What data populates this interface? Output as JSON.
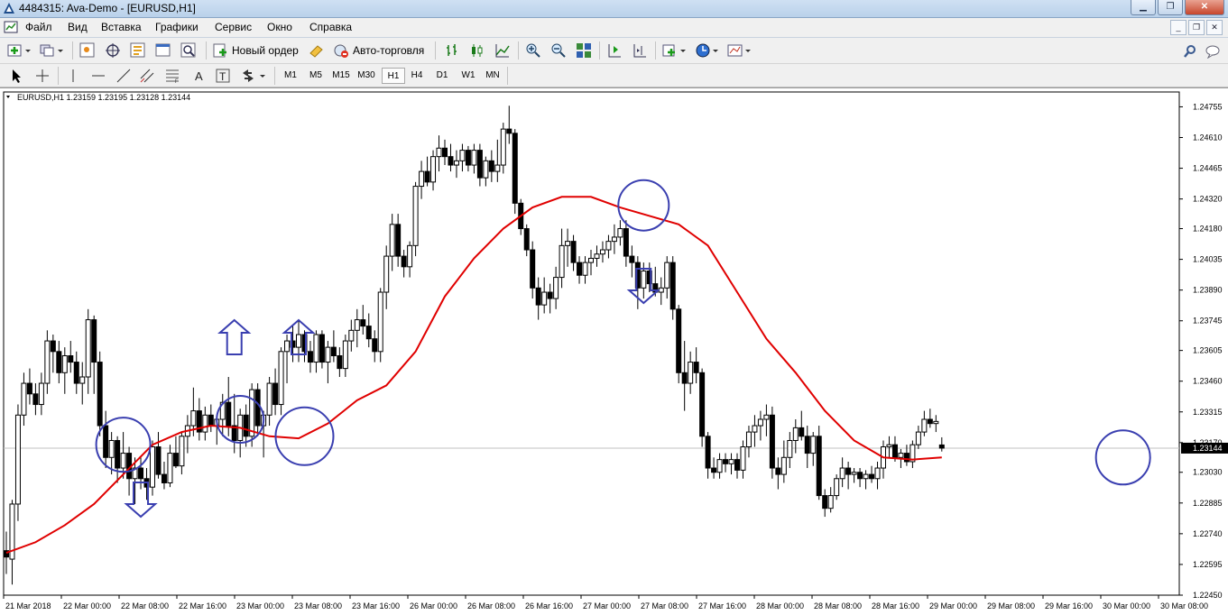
{
  "window": {
    "title": "4484315: Ava-Demo - [EURUSD,H1]"
  },
  "menu": [
    "Файл",
    "Вид",
    "Вставка",
    "Графики",
    "Сервис",
    "Окно",
    "Справка"
  ],
  "toolbar": {
    "new_order": "Новый ордер",
    "auto_trading": "Авто-торговля"
  },
  "timeframes": [
    "M1",
    "M5",
    "M15",
    "M30",
    "H1",
    "H4",
    "D1",
    "W1",
    "MN"
  ],
  "active_timeframe": "H1",
  "chart": {
    "symbol_label": "EURUSD,H1  1.23159 1.23195 1.23128 1.23144",
    "current_price": "1.23144",
    "price_ticks": [
      "1.24755",
      "1.24610",
      "1.24465",
      "1.24320",
      "1.24180",
      "1.24035",
      "1.23890",
      "1.23745",
      "1.23605",
      "1.23460",
      "1.23315",
      "1.23170",
      "1.23030",
      "1.22885",
      "1.22740",
      "1.22595",
      "1.22450"
    ],
    "time_ticks": [
      "21 Mar 2018",
      "22 Mar 00:00",
      "22 Mar 08:00",
      "22 Mar 16:00",
      "23 Mar 00:00",
      "23 Mar 08:00",
      "23 Mar 16:00",
      "26 Mar 00:00",
      "26 Mar 08:00",
      "26 Mar 16:00",
      "27 Mar 00:00",
      "27 Mar 08:00",
      "27 Mar 16:00",
      "28 Mar 00:00",
      "28 Mar 08:00",
      "28 Mar 16:00",
      "29 Mar 00:00",
      "29 Mar 08:00",
      "29 Mar 16:00",
      "30 Mar 00:00",
      "30 Mar 08:00"
    ],
    "colors": {
      "ma": "#e00000",
      "annotation": "#3a3fb0",
      "bull": "#ffffff",
      "bear": "#000000"
    }
  },
  "chart_data": {
    "type": "candlestick",
    "symbol": "EURUSD",
    "timeframe": "H1",
    "ylim": [
      1.2245,
      1.2476
    ],
    "last": {
      "open": 1.23159,
      "high": 1.23195,
      "low": 1.23128,
      "close": 1.23144
    },
    "ohlc": [
      [
        1.2266,
        1.2275,
        1.2255,
        1.2263
      ],
      [
        1.2262,
        1.229,
        1.225,
        1.2288
      ],
      [
        1.2288,
        1.2335,
        1.228,
        1.233
      ],
      [
        1.233,
        1.235,
        1.2325,
        1.2345
      ],
      [
        1.2345,
        1.2352,
        1.2335,
        1.234
      ],
      [
        1.234,
        1.2345,
        1.233,
        1.2335
      ],
      [
        1.2335,
        1.235,
        1.233,
        1.2345
      ],
      [
        1.2345,
        1.237,
        1.234,
        1.2365
      ],
      [
        1.2365,
        1.2368,
        1.235,
        1.236
      ],
      [
        1.236,
        1.2365,
        1.2345,
        1.235
      ],
      [
        1.235,
        1.2362,
        1.234,
        1.2358
      ],
      [
        1.2358,
        1.2365,
        1.235,
        1.2355
      ],
      [
        1.2355,
        1.236,
        1.234,
        1.2345
      ],
      [
        1.2345,
        1.2355,
        1.2335,
        1.2348
      ],
      [
        1.2348,
        1.238,
        1.234,
        1.2375
      ],
      [
        1.2375,
        1.2377,
        1.234,
        1.2355
      ],
      [
        1.2355,
        1.236,
        1.232,
        1.2325
      ],
      [
        1.2325,
        1.2332,
        1.2305,
        1.231
      ],
      [
        1.231,
        1.2322,
        1.2302,
        1.2318
      ],
      [
        1.2318,
        1.232,
        1.2298,
        1.2305
      ],
      [
        1.2305,
        1.2322,
        1.23,
        1.2312
      ],
      [
        1.2312,
        1.2315,
        1.2292,
        1.23
      ],
      [
        1.23,
        1.231,
        1.2288,
        1.2305
      ],
      [
        1.2305,
        1.231,
        1.2295,
        1.23
      ],
      [
        1.23,
        1.2305,
        1.229,
        1.2296
      ],
      [
        1.2296,
        1.2318,
        1.2292,
        1.2315
      ],
      [
        1.2315,
        1.2322,
        1.23,
        1.2302
      ],
      [
        1.2302,
        1.2308,
        1.2295,
        1.2298
      ],
      [
        1.2298,
        1.2316,
        1.2296,
        1.2312
      ],
      [
        1.2312,
        1.232,
        1.2305,
        1.2306
      ],
      [
        1.2306,
        1.2322,
        1.2302,
        1.232
      ],
      [
        1.232,
        1.233,
        1.2312,
        1.2325
      ],
      [
        1.2325,
        1.2343,
        1.232,
        1.2332
      ],
      [
        1.2332,
        1.2338,
        1.2318,
        1.2322
      ],
      [
        1.2322,
        1.2334,
        1.2318,
        1.233
      ],
      [
        1.233,
        1.2335,
        1.2322,
        1.2325
      ],
      [
        1.2325,
        1.233,
        1.2316,
        1.2328
      ],
      [
        1.2328,
        1.234,
        1.232,
        1.2336
      ],
      [
        1.2336,
        1.2348,
        1.232,
        1.2325
      ],
      [
        1.2325,
        1.234,
        1.2312,
        1.2318
      ],
      [
        1.2318,
        1.2333,
        1.231,
        1.233
      ],
      [
        1.233,
        1.2335,
        1.2315,
        1.232
      ],
      [
        1.232,
        1.2345,
        1.2315,
        1.2342
      ],
      [
        1.2342,
        1.2345,
        1.232,
        1.2325
      ],
      [
        1.2325,
        1.2332,
        1.231,
        1.233
      ],
      [
        1.233,
        1.2348,
        1.2325,
        1.2345
      ],
      [
        1.2345,
        1.2352,
        1.233,
        1.2335
      ],
      [
        1.2335,
        1.2362,
        1.233,
        1.236
      ],
      [
        1.236,
        1.2368,
        1.2345,
        1.2365
      ],
      [
        1.2365,
        1.2372,
        1.2355,
        1.2362
      ],
      [
        1.2362,
        1.2375,
        1.2355,
        1.2368
      ],
      [
        1.2368,
        1.237,
        1.2355,
        1.236
      ],
      [
        1.236,
        1.2365,
        1.235,
        1.2355
      ],
      [
        1.2355,
        1.237,
        1.235,
        1.2368
      ],
      [
        1.2368,
        1.237,
        1.2352,
        1.2355
      ],
      [
        1.2355,
        1.2365,
        1.2345,
        1.2362
      ],
      [
        1.2362,
        1.237,
        1.2355,
        1.2358
      ],
      [
        1.2358,
        1.2362,
        1.2348,
        1.2352
      ],
      [
        1.2352,
        1.2368,
        1.2348,
        1.2365
      ],
      [
        1.2365,
        1.2375,
        1.236,
        1.237
      ],
      [
        1.237,
        1.238,
        1.2362,
        1.2375
      ],
      [
        1.2375,
        1.2382,
        1.2368,
        1.2372
      ],
      [
        1.2372,
        1.2378,
        1.2362,
        1.2366
      ],
      [
        1.2366,
        1.237,
        1.2355,
        1.236
      ],
      [
        1.236,
        1.239,
        1.2355,
        1.2388
      ],
      [
        1.2388,
        1.241,
        1.238,
        1.2405
      ],
      [
        1.2405,
        1.2425,
        1.2398,
        1.242
      ],
      [
        1.242,
        1.2425,
        1.24,
        1.2405
      ],
      [
        1.2405,
        1.2408,
        1.2395,
        1.24
      ],
      [
        1.24,
        1.2412,
        1.2395,
        1.241
      ],
      [
        1.241,
        1.244,
        1.2405,
        1.2438
      ],
      [
        1.2438,
        1.245,
        1.2432,
        1.2445
      ],
      [
        1.2445,
        1.2452,
        1.2438,
        1.244
      ],
      [
        1.244,
        1.2455,
        1.2436,
        1.2452
      ],
      [
        1.2452,
        1.2462,
        1.2445,
        1.2456
      ],
      [
        1.2456,
        1.246,
        1.2448,
        1.2452
      ],
      [
        1.2452,
        1.2458,
        1.2445,
        1.2448
      ],
      [
        1.2448,
        1.2455,
        1.2442,
        1.245
      ],
      [
        1.245,
        1.2458,
        1.2445,
        1.2455
      ],
      [
        1.2455,
        1.2457,
        1.2445,
        1.2448
      ],
      [
        1.2448,
        1.2458,
        1.2444,
        1.2455
      ],
      [
        1.2455,
        1.2458,
        1.2438,
        1.2442
      ],
      [
        1.2442,
        1.2452,
        1.2438,
        1.245
      ],
      [
        1.245,
        1.2455,
        1.244,
        1.2445
      ],
      [
        1.2445,
        1.246,
        1.244,
        1.2448
      ],
      [
        1.2448,
        1.2468,
        1.2444,
        1.2465
      ],
      [
        1.2465,
        1.2476,
        1.2458,
        1.2463
      ],
      [
        1.2463,
        1.2465,
        1.2425,
        1.243
      ],
      [
        1.243,
        1.2432,
        1.2415,
        1.2418
      ],
      [
        1.2418,
        1.242,
        1.2405,
        1.2408
      ],
      [
        1.2408,
        1.2412,
        1.2385,
        1.239
      ],
      [
        1.239,
        1.2395,
        1.2375,
        1.2382
      ],
      [
        1.2382,
        1.2395,
        1.2378,
        1.2388
      ],
      [
        1.2388,
        1.2392,
        1.2378,
        1.2385
      ],
      [
        1.2385,
        1.24,
        1.238,
        1.2395
      ],
      [
        1.2395,
        1.2418,
        1.239,
        1.241
      ],
      [
        1.241,
        1.2418,
        1.24,
        1.2412
      ],
      [
        1.2412,
        1.2415,
        1.2398,
        1.2402
      ],
      [
        1.2402,
        1.2405,
        1.2392,
        1.2396
      ],
      [
        1.2396,
        1.2405,
        1.2392,
        1.2402
      ],
      [
        1.2402,
        1.2408,
        1.2396,
        1.2404
      ],
      [
        1.2404,
        1.241,
        1.24,
        1.2406
      ],
      [
        1.2406,
        1.2412,
        1.2402,
        1.2408
      ],
      [
        1.2408,
        1.2415,
        1.2404,
        1.2412
      ],
      [
        1.2412,
        1.242,
        1.2406,
        1.2414
      ],
      [
        1.2414,
        1.2422,
        1.241,
        1.2418
      ],
      [
        1.2418,
        1.2422,
        1.24,
        1.2405
      ],
      [
        1.2405,
        1.241,
        1.2395,
        1.2402
      ],
      [
        1.2402,
        1.2405,
        1.238,
        1.239
      ],
      [
        1.239,
        1.2402,
        1.2385,
        1.2398
      ],
      [
        1.2398,
        1.2402,
        1.2388,
        1.2392
      ],
      [
        1.2392,
        1.24,
        1.2386,
        1.2388
      ],
      [
        1.2388,
        1.2395,
        1.2382,
        1.239
      ],
      [
        1.239,
        1.2405,
        1.2385,
        1.2402
      ],
      [
        1.2402,
        1.2405,
        1.2375,
        1.238
      ],
      [
        1.238,
        1.2382,
        1.2345,
        1.235
      ],
      [
        1.235,
        1.2365,
        1.2332,
        1.2345
      ],
      [
        1.2345,
        1.236,
        1.234,
        1.2355
      ],
      [
        1.2355,
        1.2362,
        1.2345,
        1.235
      ],
      [
        1.235,
        1.2352,
        1.2315,
        1.232
      ],
      [
        1.232,
        1.2322,
        1.23,
        1.2305
      ],
      [
        1.2305,
        1.231,
        1.23,
        1.2303
      ],
      [
        1.2303,
        1.2312,
        1.23,
        1.2309
      ],
      [
        1.2309,
        1.2312,
        1.2303,
        1.2307
      ],
      [
        1.2307,
        1.2312,
        1.2302,
        1.2309
      ],
      [
        1.2309,
        1.2312,
        1.23,
        1.2304
      ],
      [
        1.2304,
        1.2318,
        1.23,
        1.2315
      ],
      [
        1.2315,
        1.2325,
        1.231,
        1.2322
      ],
      [
        1.2322,
        1.233,
        1.2315,
        1.2325
      ],
      [
        1.2325,
        1.2332,
        1.2318,
        1.2328
      ],
      [
        1.2328,
        1.2335,
        1.232,
        1.233
      ],
      [
        1.233,
        1.2334,
        1.23,
        1.2305
      ],
      [
        1.2305,
        1.231,
        1.2295,
        1.2302
      ],
      [
        1.2302,
        1.2318,
        1.2298,
        1.231
      ],
      [
        1.231,
        1.2322,
        1.2305,
        1.2318
      ],
      [
        1.2318,
        1.2328,
        1.2312,
        1.2324
      ],
      [
        1.2324,
        1.2332,
        1.2318,
        1.232
      ],
      [
        1.232,
        1.2325,
        1.2305,
        1.2312
      ],
      [
        1.2312,
        1.2322,
        1.2306,
        1.232
      ],
      [
        1.232,
        1.2325,
        1.229,
        1.2292
      ],
      [
        1.2292,
        1.2295,
        1.2282,
        1.2286
      ],
      [
        1.2286,
        1.2296,
        1.2284,
        1.2292
      ],
      [
        1.2292,
        1.2302,
        1.229,
        1.23
      ],
      [
        1.23,
        1.231,
        1.2296,
        1.2305
      ],
      [
        1.2305,
        1.2308,
        1.2295,
        1.2302
      ],
      [
        1.2302,
        1.2305,
        1.2298,
        1.2303
      ],
      [
        1.2303,
        1.2305,
        1.2296,
        1.23
      ],
      [
        1.23,
        1.2304,
        1.2295,
        1.2302
      ],
      [
        1.2302,
        1.2306,
        1.2298,
        1.23
      ],
      [
        1.23,
        1.2308,
        1.2295,
        1.2305
      ],
      [
        1.2305,
        1.2318,
        1.23,
        1.2315
      ],
      [
        1.2315,
        1.232,
        1.231,
        1.2316
      ],
      [
        1.2316,
        1.232,
        1.2308,
        1.231
      ],
      [
        1.231,
        1.2314,
        1.2305,
        1.2312
      ],
      [
        1.2312,
        1.2316,
        1.2306,
        1.2308
      ],
      [
        1.2308,
        1.2318,
        1.2305,
        1.2316
      ],
      [
        1.2316,
        1.2325,
        1.2314,
        1.2322
      ],
      [
        1.2322,
        1.2332,
        1.232,
        1.2328
      ],
      [
        1.2328,
        1.2333,
        1.2324,
        1.2326
      ],
      [
        1.2326,
        1.233,
        1.2322,
        1.2327
      ],
      [
        1.23159,
        1.23195,
        1.23128,
        1.23144
      ]
    ],
    "moving_average": [
      [
        0,
        1.2265
      ],
      [
        5,
        1.227
      ],
      [
        10,
        1.2278
      ],
      [
        15,
        1.2288
      ],
      [
        20,
        1.2302
      ],
      [
        25,
        1.2316
      ],
      [
        30,
        1.2322
      ],
      [
        35,
        1.2325
      ],
      [
        40,
        1.2324
      ],
      [
        45,
        1.232
      ],
      [
        50,
        1.2319
      ],
      [
        55,
        1.2326
      ],
      [
        60,
        1.2337
      ],
      [
        65,
        1.2344
      ],
      [
        70,
        1.236
      ],
      [
        75,
        1.2386
      ],
      [
        80,
        1.2404
      ],
      [
        85,
        1.2418
      ],
      [
        90,
        1.2428
      ],
      [
        95,
        1.2433
      ],
      [
        100,
        1.2433
      ],
      [
        105,
        1.2428
      ],
      [
        110,
        1.2424
      ],
      [
        115,
        1.242
      ],
      [
        120,
        1.241
      ],
      [
        125,
        1.2388
      ],
      [
        130,
        1.2366
      ],
      [
        135,
        1.235
      ],
      [
        140,
        1.2332
      ],
      [
        145,
        1.2318
      ],
      [
        150,
        1.231
      ],
      [
        155,
        1.2309
      ],
      [
        160,
        1.231
      ]
    ]
  }
}
